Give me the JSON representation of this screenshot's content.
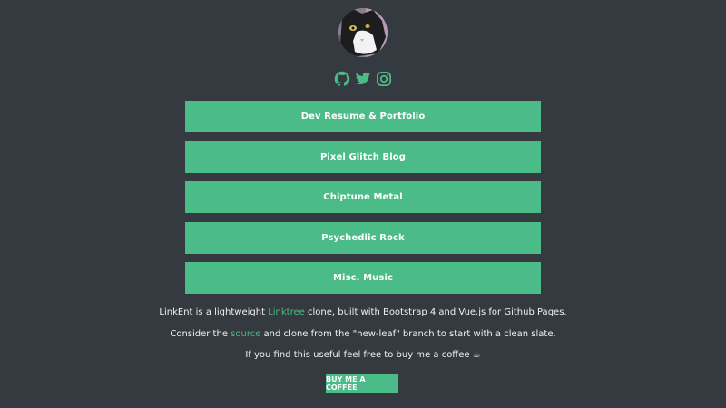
{
  "profile": {
    "avatar_icon": "cat-avatar-photo"
  },
  "socials": [
    {
      "name": "github-icon"
    },
    {
      "name": "twitter-icon"
    },
    {
      "name": "instagram-icon"
    }
  ],
  "links": [
    {
      "label": "Dev Resume & Portfolio"
    },
    {
      "label": "Pixel Glitch Blog"
    },
    {
      "label": "Chiptune Metal"
    },
    {
      "label": "Psychedlic Rock"
    },
    {
      "label": "Misc. Music"
    }
  ],
  "footer": {
    "line1_pre": "LinkEnt is a lightweight ",
    "line1_link": "Linktree",
    "line1_post": " clone, built with Bootstrap 4 and Vue.js for Github Pages.",
    "line2_pre": "Consider the ",
    "line2_link": "source",
    "line2_post": " and clone from the \"new-leaf\" branch to start with a clean slate.",
    "line3": "If you find this useful feel free to buy me a coffee ☕",
    "coffee_button": "BUY ME A COFFEE"
  },
  "colors": {
    "background": "#343a40",
    "accent": "#4bbb87"
  }
}
